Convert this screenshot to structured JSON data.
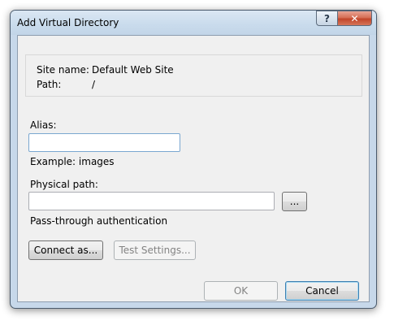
{
  "window": {
    "title": "Add Virtual Directory",
    "help_symbol": "?",
    "close_symbol": "✕"
  },
  "info": {
    "site_name_label": "Site name:",
    "site_name_value": "Default Web Site",
    "path_label": "Path:",
    "path_value": "/"
  },
  "alias": {
    "label": "Alias:",
    "value": "",
    "example": "Example: images"
  },
  "physical_path": {
    "label": "Physical path:",
    "value": "",
    "browse_label": "..."
  },
  "auth": {
    "label": "Pass-through authentication",
    "connect_as_label": "Connect as...",
    "test_settings_label": "Test Settings..."
  },
  "footer": {
    "ok_label": "OK",
    "cancel_label": "Cancel"
  },
  "colors": {
    "frame": "#c7d8ea",
    "client": "#f0f0f0",
    "close_button": "#c2452a"
  }
}
